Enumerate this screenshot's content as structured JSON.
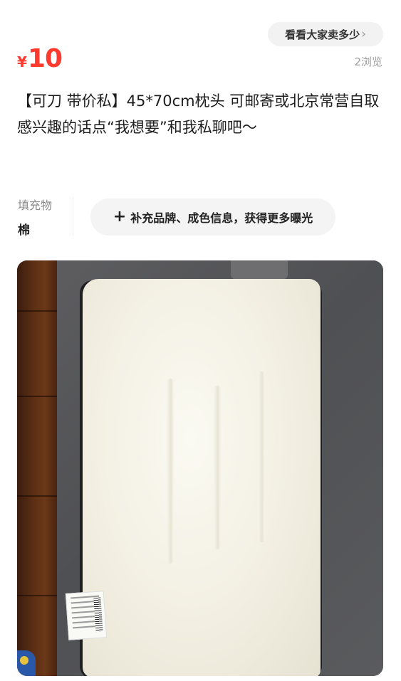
{
  "header": {
    "compare_chip_label": "看看大家卖多少",
    "currency": "¥",
    "price": "10",
    "views": "2浏览"
  },
  "description": {
    "line1": "【可刀 带价私】45*70cm枕头 可邮寄或北京常营自取",
    "line2": "感兴趣的话点“我想要”和我私聊吧～"
  },
  "attributes": {
    "filling_label": "填充物",
    "filling_value": "棉",
    "supplement_label": "补充品牌、成色信息，获得更多曝光"
  },
  "colors": {
    "price": "#ff3b30",
    "chip_bg": "#f2f2f2",
    "muted_text": "#a0a0a0"
  },
  "icons": {
    "chevron": "chevron-right-icon",
    "plus": "plus-icon"
  }
}
